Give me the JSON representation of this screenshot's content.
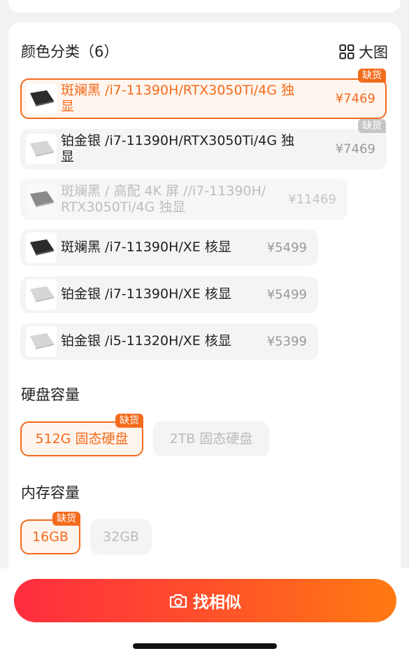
{
  "color": {
    "title": "颜色分类（6）",
    "big_view_label": "大图",
    "options": [
      {
        "line1": "斑斓黑 /i7-11390H/RTX3050Ti/4G 独",
        "line2": "显",
        "price": "¥7469",
        "badge": "缺货",
        "laptop_color": "#2b2b2b"
      },
      {
        "line1": "铂金银 /i7-11390H/RTX3050Ti/4G 独",
        "line2": "显",
        "price": "¥7469",
        "badge": "缺货",
        "laptop_color": "#d6d6d6"
      },
      {
        "line1": "斑斓黑 / 高配 4K 屏 //i7-11390H/",
        "line2": "RTX3050Ti/4G 独显",
        "price": "¥11469",
        "badge": "",
        "laptop_color": "#8a8a8a"
      },
      {
        "line1": "斑斓黑 /i7-11390H/XE 核显",
        "line2": "",
        "price": "¥5499",
        "badge": "",
        "laptop_color": "#2b2b2b"
      },
      {
        "line1": "铂金银 /i7-11390H/XE 核显",
        "line2": "",
        "price": "¥5499",
        "badge": "",
        "laptop_color": "#d6d6d6"
      },
      {
        "line1": "铂金银 /i5-11320H/XE 核显",
        "line2": "",
        "price": "¥5399",
        "badge": "",
        "laptop_color": "#d6d6d6"
      }
    ]
  },
  "storage": {
    "title": "硬盘容量",
    "options": [
      {
        "label": "512G 固态硬盘",
        "badge": "缺货"
      },
      {
        "label": "2TB 固态硬盘"
      }
    ]
  },
  "memory": {
    "title": "内存容量",
    "options": [
      {
        "label": "16GB",
        "badge": "缺货"
      },
      {
        "label": "32GB"
      }
    ]
  },
  "cta": {
    "label": "找相似"
  },
  "colors": {
    "accent": "#f36b1c",
    "cta_start": "#ff2d3f",
    "cta_end": "#ff7a12"
  }
}
